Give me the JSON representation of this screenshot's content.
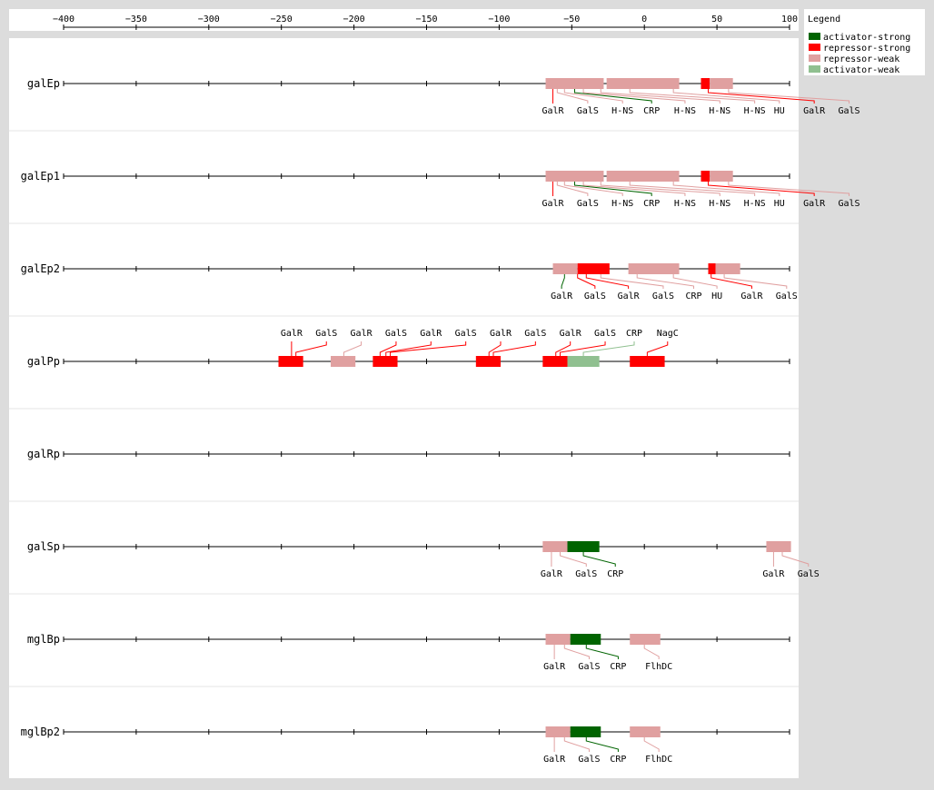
{
  "axis": {
    "ticks": [
      -400,
      -350,
      -300,
      -250,
      -200,
      -150,
      -100,
      -50,
      0,
      50,
      100
    ],
    "labels": [
      "−400",
      "−350",
      "−300",
      "−250",
      "−200",
      "−150",
      "−100",
      "−50",
      "0",
      "50",
      "100"
    ]
  },
  "legend": {
    "title": "Legend",
    "items": [
      {
        "label": "activator-strong",
        "color": "#006400"
      },
      {
        "label": "repressor-strong",
        "color": "#ff0000"
      },
      {
        "label": "repressor-weak",
        "color": "#e0a0a0"
      },
      {
        "label": "activator-weak",
        "color": "#90c090"
      }
    ]
  },
  "chart_data": {
    "type": "diagram",
    "xlim": [
      -400,
      100
    ],
    "promoters": [
      {
        "name": "galEp",
        "sites": [
          {
            "start": -68,
            "end": -28,
            "kind": "repressor-weak"
          },
          {
            "start": -26,
            "end": 24,
            "kind": "repressor-weak"
          },
          {
            "start": 39,
            "end": 45,
            "kind": "repressor-strong"
          },
          {
            "start": 45,
            "end": 61,
            "kind": "repressor-weak"
          }
        ],
        "labels": [
          {
            "text": "GalR",
            "at": -63,
            "kind": "repressor-strong",
            "from": -63
          },
          {
            "text": "GalS",
            "at": -39,
            "kind": "repressor-weak",
            "from": -60
          },
          {
            "text": "H-NS",
            "at": -15,
            "kind": "repressor-weak",
            "from": -55
          },
          {
            "text": "CRP",
            "at": 5,
            "kind": "activator-strong",
            "from": -48
          },
          {
            "text": "H-NS",
            "at": 28,
            "kind": "repressor-weak",
            "from": -42
          },
          {
            "text": "H-NS",
            "at": 52,
            "kind": "repressor-weak",
            "from": -30
          },
          {
            "text": "H-NS",
            "at": 76,
            "kind": "repressor-weak",
            "from": -10
          },
          {
            "text": "HU",
            "at": 93,
            "kind": "repressor-weak",
            "from": 20
          },
          {
            "text": "GalR",
            "at": 117,
            "kind": "repressor-strong",
            "from": 44
          },
          {
            "text": "GalS",
            "at": 141,
            "kind": "repressor-weak",
            "from": 58
          }
        ]
      },
      {
        "name": "galEp1",
        "sites": [
          {
            "start": -68,
            "end": -28,
            "kind": "repressor-weak"
          },
          {
            "start": -26,
            "end": 24,
            "kind": "repressor-weak"
          },
          {
            "start": 39,
            "end": 45,
            "kind": "repressor-strong"
          },
          {
            "start": 45,
            "end": 61,
            "kind": "repressor-weak"
          }
        ],
        "labels": [
          {
            "text": "GalR",
            "at": -63,
            "kind": "repressor-strong",
            "from": -63
          },
          {
            "text": "GalS",
            "at": -39,
            "kind": "repressor-weak",
            "from": -60
          },
          {
            "text": "H-NS",
            "at": -15,
            "kind": "repressor-weak",
            "from": -55
          },
          {
            "text": "CRP",
            "at": 5,
            "kind": "activator-strong",
            "from": -48
          },
          {
            "text": "H-NS",
            "at": 28,
            "kind": "repressor-weak",
            "from": -42
          },
          {
            "text": "H-NS",
            "at": 52,
            "kind": "repressor-weak",
            "from": -30
          },
          {
            "text": "H-NS",
            "at": 76,
            "kind": "repressor-weak",
            "from": -10
          },
          {
            "text": "HU",
            "at": 93,
            "kind": "repressor-weak",
            "from": 20
          },
          {
            "text": "GalR",
            "at": 117,
            "kind": "repressor-strong",
            "from": 44
          },
          {
            "text": "GalS",
            "at": 141,
            "kind": "repressor-weak",
            "from": 58
          }
        ]
      },
      {
        "name": "galEp2",
        "sites": [
          {
            "start": -63,
            "end": -46,
            "kind": "repressor-weak"
          },
          {
            "start": -46,
            "end": -24,
            "kind": "repressor-strong"
          },
          {
            "start": -11,
            "end": 24,
            "kind": "repressor-weak"
          },
          {
            "start": 44,
            "end": 49,
            "kind": "repressor-strong"
          },
          {
            "start": 49,
            "end": 66,
            "kind": "repressor-weak"
          }
        ],
        "labels": [
          {
            "text": "GalR",
            "at": -57,
            "kind": "activator-strong",
            "from": -55
          },
          {
            "text": "GalS",
            "at": -34,
            "kind": "repressor-strong",
            "from": -46
          },
          {
            "text": "GalR",
            "at": -11,
            "kind": "repressor-strong",
            "from": -40
          },
          {
            "text": "GalS",
            "at": 13,
            "kind": "repressor-weak",
            "from": -30
          },
          {
            "text": "CRP",
            "at": 34,
            "kind": "repressor-weak",
            "from": -5
          },
          {
            "text": "HU",
            "at": 50,
            "kind": "repressor-weak",
            "from": 20
          },
          {
            "text": "GalR",
            "at": 74,
            "kind": "repressor-strong",
            "from": 46
          },
          {
            "text": "GalS",
            "at": 98,
            "kind": "repressor-weak",
            "from": 55
          }
        ]
      },
      {
        "name": "galPp",
        "sites": [
          {
            "start": -252,
            "end": -235,
            "kind": "repressor-strong"
          },
          {
            "start": -216,
            "end": -199,
            "kind": "repressor-weak"
          },
          {
            "start": -187,
            "end": -170,
            "kind": "repressor-strong"
          },
          {
            "start": -116,
            "end": -99,
            "kind": "repressor-strong"
          },
          {
            "start": -70,
            "end": -53,
            "kind": "repressor-strong"
          },
          {
            "start": -53,
            "end": -31,
            "kind": "activator-weak"
          },
          {
            "start": -10,
            "end": 14,
            "kind": "repressor-strong"
          }
        ],
        "labels": [
          {
            "text": "GalR",
            "at": -243,
            "kind": "repressor-strong",
            "from": -243
          },
          {
            "text": "GalS",
            "at": -219,
            "kind": "repressor-strong",
            "from": -240
          },
          {
            "text": "GalR",
            "at": -195,
            "kind": "repressor-weak",
            "from": -207
          },
          {
            "text": "GalS",
            "at": -171,
            "kind": "repressor-strong",
            "from": -182
          },
          {
            "text": "GalR",
            "at": -147,
            "kind": "repressor-strong",
            "from": -178
          },
          {
            "text": "GalS",
            "at": -123,
            "kind": "repressor-strong",
            "from": -175
          },
          {
            "text": "GalR",
            "at": -99,
            "kind": "repressor-strong",
            "from": -107
          },
          {
            "text": "GalS",
            "at": -75,
            "kind": "repressor-strong",
            "from": -104
          },
          {
            "text": "GalR",
            "at": -51,
            "kind": "repressor-strong",
            "from": -61
          },
          {
            "text": "GalS",
            "at": -27,
            "kind": "repressor-strong",
            "from": -58
          },
          {
            "text": "CRP",
            "at": -7,
            "kind": "activator-weak",
            "from": -42
          },
          {
            "text": "NagC",
            "at": 16,
            "kind": "repressor-strong",
            "from": 2
          }
        ]
      },
      {
        "name": "galRp",
        "sites": [],
        "labels": []
      },
      {
        "name": "galSp",
        "sites": [
          {
            "start": -70,
            "end": -53,
            "kind": "repressor-weak"
          },
          {
            "start": -53,
            "end": -31,
            "kind": "activator-strong"
          },
          {
            "start": 84,
            "end": 101,
            "kind": "repressor-weak"
          }
        ],
        "labels": [
          {
            "text": "GalR",
            "at": -64,
            "kind": "repressor-weak",
            "from": -64
          },
          {
            "text": "GalS",
            "at": -40,
            "kind": "repressor-weak",
            "from": -58
          },
          {
            "text": "CRP",
            "at": -20,
            "kind": "activator-strong",
            "from": -42
          },
          {
            "text": "GalR",
            "at": 89,
            "kind": "repressor-weak",
            "from": 89
          },
          {
            "text": "GalS",
            "at": 113,
            "kind": "repressor-weak",
            "from": 95
          }
        ]
      },
      {
        "name": "mglBp",
        "sites": [
          {
            "start": -68,
            "end": -51,
            "kind": "repressor-weak"
          },
          {
            "start": -51,
            "end": -30,
            "kind": "activator-strong"
          },
          {
            "start": -10,
            "end": 11,
            "kind": "repressor-weak"
          }
        ],
        "labels": [
          {
            "text": "GalR",
            "at": -62,
            "kind": "repressor-weak",
            "from": -62
          },
          {
            "text": "GalS",
            "at": -38,
            "kind": "repressor-weak",
            "from": -55
          },
          {
            "text": "CRP",
            "at": -18,
            "kind": "activator-strong",
            "from": -40
          },
          {
            "text": "FlhDC",
            "at": 10,
            "kind": "repressor-weak",
            "from": 0
          }
        ]
      },
      {
        "name": "mglBp2",
        "sites": [
          {
            "start": -68,
            "end": -51,
            "kind": "repressor-weak"
          },
          {
            "start": -51,
            "end": -30,
            "kind": "activator-strong"
          },
          {
            "start": -10,
            "end": 11,
            "kind": "repressor-weak"
          }
        ],
        "labels": [
          {
            "text": "GalR",
            "at": -62,
            "kind": "repressor-weak",
            "from": -62
          },
          {
            "text": "GalS",
            "at": -38,
            "kind": "repressor-weak",
            "from": -55
          },
          {
            "text": "CRP",
            "at": -18,
            "kind": "activator-strong",
            "from": -40
          },
          {
            "text": "FlhDC",
            "at": 10,
            "kind": "repressor-weak",
            "from": 0
          }
        ]
      }
    ]
  }
}
